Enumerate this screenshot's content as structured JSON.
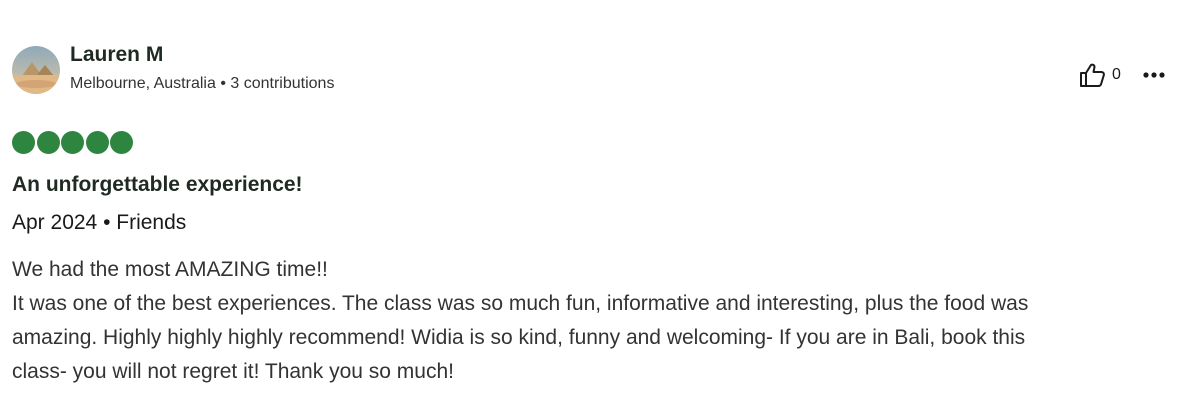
{
  "reviewer": {
    "name": "Lauren M",
    "location": "Melbourne, Australia",
    "separator": "•",
    "contributions": "3 contributions"
  },
  "helpful": {
    "icon": "thumbs-up-icon",
    "count": "0"
  },
  "more_menu": {
    "icon": "more-dots-icon"
  },
  "rating": {
    "value": 5,
    "max": 5,
    "color": "#2e8540"
  },
  "review": {
    "title": "An unforgettable experience!",
    "date_line": "Apr 2024 • Friends",
    "body_lines": [
      "We had the most AMAZING time!!",
      "It was one of the best experiences. The class was so much fun, informative and interesting, plus the food was",
      "amazing. Highly highly highly recommend! Widia is so kind, funny and welcoming- If you are in Bali, book this",
      "class- you will not regret it! Thank you so much!"
    ]
  }
}
